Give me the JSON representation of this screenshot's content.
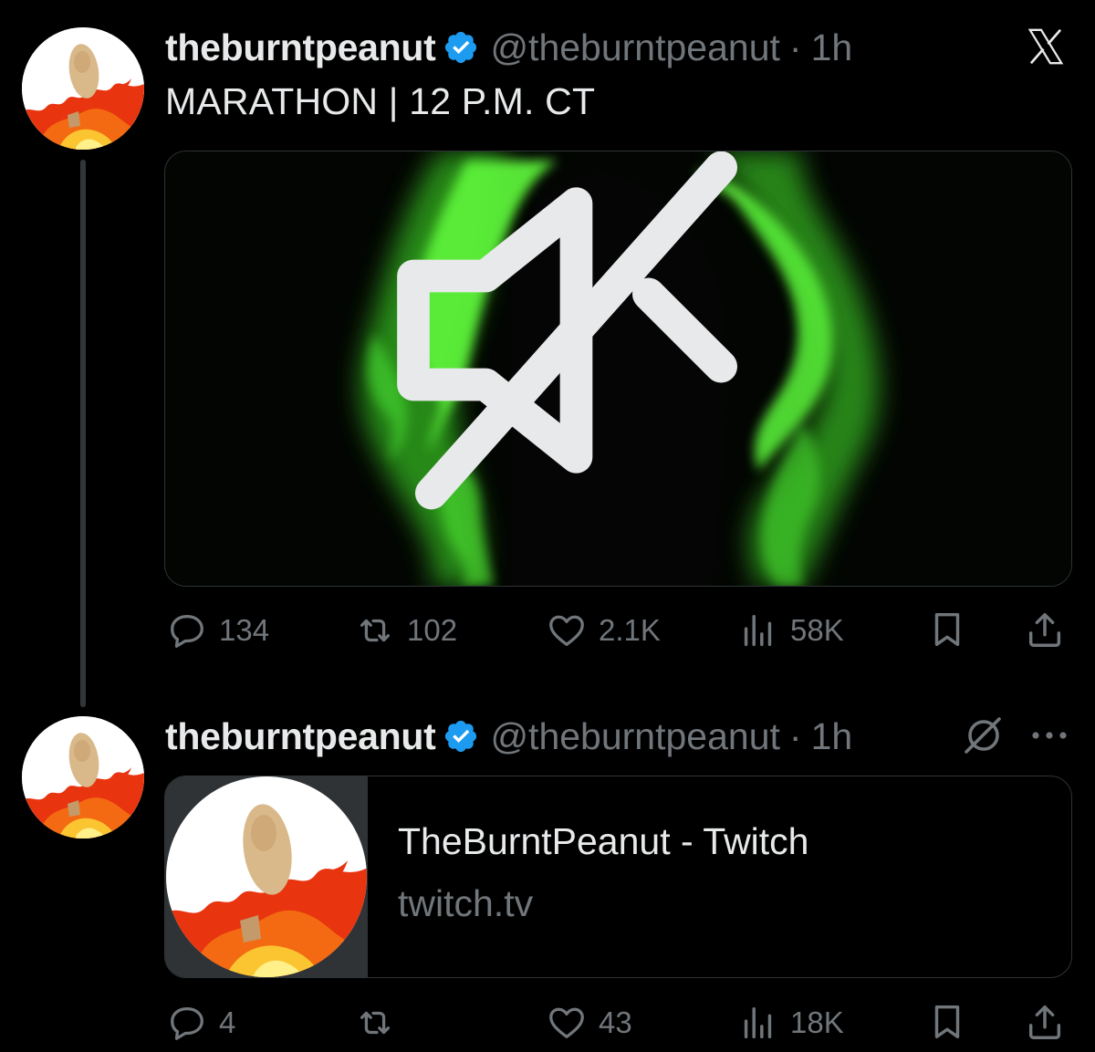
{
  "colors": {
    "background": "#000000",
    "primary_text": "#e7e9ea",
    "secondary_text": "#71767b",
    "verified_blue": "#1d9bf0",
    "border": "#2f3336",
    "glow_green": "#5cf03a"
  },
  "app": {
    "logo_icon": "x-logo-icon"
  },
  "posts": [
    {
      "author": {
        "display_name": "theburntpeanut",
        "handle": "@theburntpeanut",
        "verified": true
      },
      "separator": "·",
      "time": "1h",
      "text": "MARATHON | 12 P.M. CT",
      "media": {
        "type": "video",
        "muted": true,
        "mute_icon": "speaker-muted-icon"
      },
      "actions": {
        "replies": "134",
        "reposts": "102",
        "likes": "2.1K",
        "views": "58K"
      }
    },
    {
      "author": {
        "display_name": "theburntpeanut",
        "handle": "@theburntpeanut",
        "verified": true
      },
      "separator": "·",
      "time": "1h",
      "link_card": {
        "title": "TheBurntPeanut - Twitch",
        "domain": "twitch.tv"
      },
      "actions": {
        "replies": "4",
        "reposts": "",
        "likes": "43",
        "views": "18K"
      }
    }
  ]
}
